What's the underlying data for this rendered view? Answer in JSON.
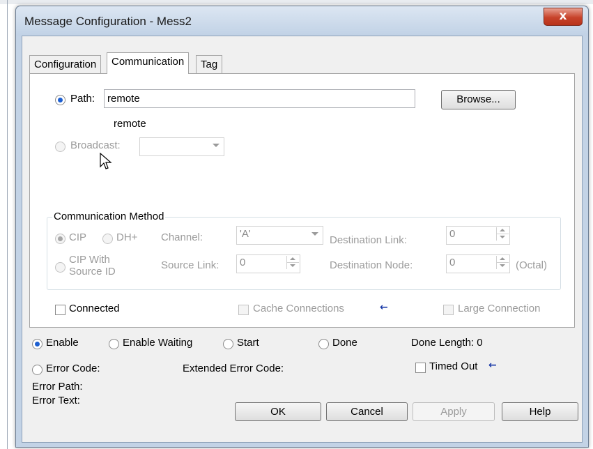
{
  "window": {
    "title": "Message Configuration - Mess2",
    "close_glyph": "x"
  },
  "tabs": [
    {
      "label": "Configuration",
      "active": false
    },
    {
      "label": "Communication",
      "active": true
    },
    {
      "label": "Tag",
      "active": false
    }
  ],
  "path": {
    "label": "Path:",
    "value": "remote",
    "hint": "remote",
    "selected": true
  },
  "browse_label": "Browse...",
  "broadcast": {
    "label": "Broadcast:",
    "value": ""
  },
  "comm_method": {
    "legend": "Communication Method",
    "cip": "CIP",
    "dh_plus": "DH+",
    "cip_with_source_id": [
      "CIP With",
      "Source ID"
    ],
    "channel_label": "Channel:",
    "channel_value": "'A'",
    "source_link_label": "Source Link:",
    "source_link_value": "0",
    "dest_link_label": "Destination Link:",
    "dest_link_value": "0",
    "dest_node_label": "Destination Node:",
    "dest_node_value": "0",
    "octal": "(Octal)"
  },
  "connected_label": "Connected",
  "cache_connections_label": "Cache Connections",
  "large_connection_label": "Large Connection",
  "status": {
    "enable": "Enable",
    "enable_waiting": "Enable Waiting",
    "start": "Start",
    "done": "Done",
    "done_length": "Done Length: 0",
    "error_code": "Error Code:",
    "extended_error_code": "Extended Error Code:",
    "timed_out": "Timed Out",
    "error_path": "Error Path:",
    "error_text": "Error Text:"
  },
  "buttons": {
    "ok": "OK",
    "cancel": "Cancel",
    "apply": "Apply",
    "help": "Help"
  },
  "icons": {
    "close": "close-icon",
    "cursor": "pointer-cursor-icon",
    "arrow": "arrow-left-icon"
  },
  "colors": {
    "accent": "#1d5fd1",
    "close": "#c7432a",
    "arrow": "#1a3aa8"
  }
}
